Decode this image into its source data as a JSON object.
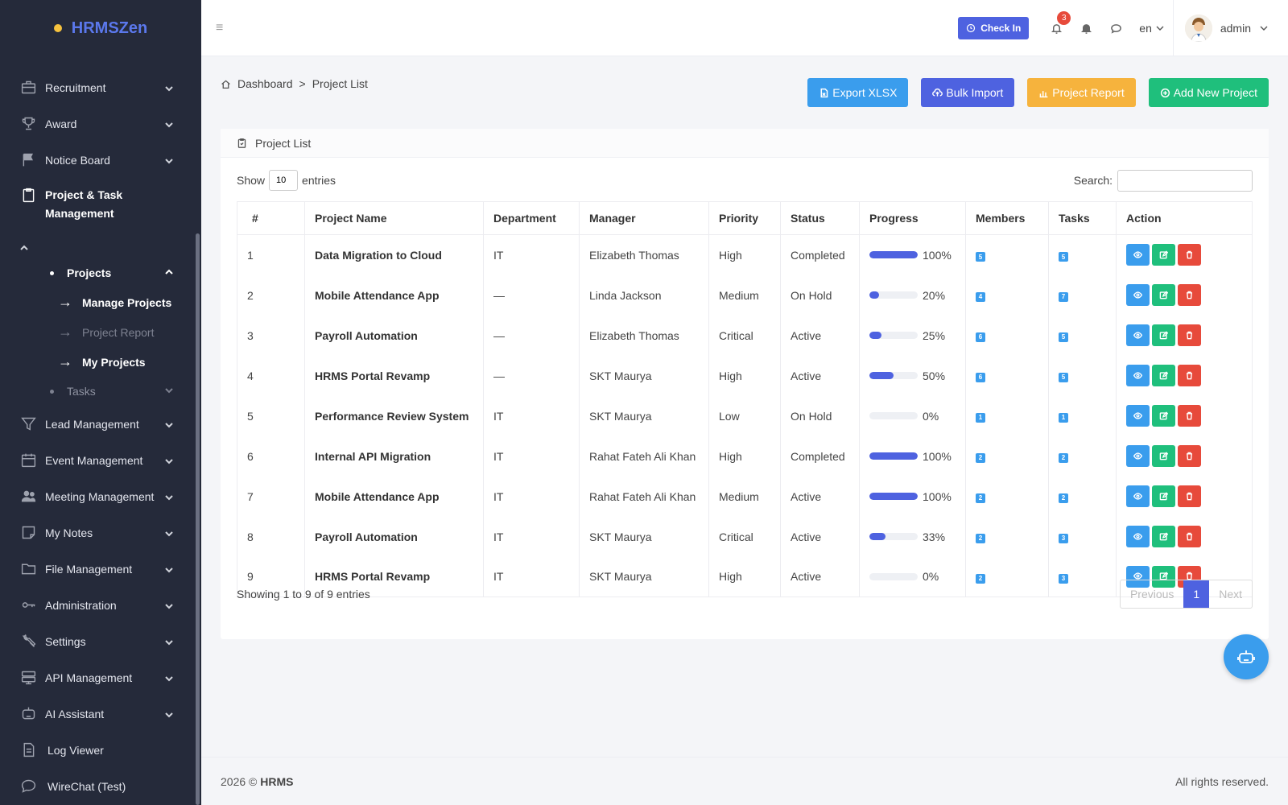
{
  "brand": {
    "name": "HRMSZen"
  },
  "sidebar": {
    "items": [
      {
        "label": "Recruitment",
        "icon": "briefcase-icon"
      },
      {
        "label": "Award",
        "icon": "trophy-icon"
      },
      {
        "label": "Notice Board",
        "icon": "flag-icon"
      },
      {
        "label": "Project & Task Management",
        "icon": "clipboard-icon"
      },
      {
        "label": "Lead Management",
        "icon": "funnel-icon"
      },
      {
        "label": "Event Management",
        "icon": "calendar-icon"
      },
      {
        "label": "Meeting Management",
        "icon": "users-icon"
      },
      {
        "label": "My Notes",
        "icon": "note-icon"
      },
      {
        "label": "File Management",
        "icon": "folder-icon"
      },
      {
        "label": "Administration",
        "icon": "key-icon"
      },
      {
        "label": "Settings",
        "icon": "wrench-icon"
      },
      {
        "label": "API Management",
        "icon": "server-icon"
      },
      {
        "label": "AI Assistant",
        "icon": "robot-icon"
      },
      {
        "label": "Log Viewer",
        "icon": "document-icon"
      },
      {
        "label": "WireChat (Test)",
        "icon": "chat-icon"
      }
    ],
    "projects_label": "Projects",
    "sub_items": [
      "Manage Projects",
      "Project Report",
      "My Projects"
    ],
    "tasks_label": "Tasks"
  },
  "header": {
    "checkin_label": "Check In",
    "notification_count": "3",
    "language": "en",
    "username": "admin"
  },
  "breadcrumb": {
    "home": "Dashboard",
    "separator": ">",
    "current": "Project List"
  },
  "actions": {
    "export": "Export XLSX",
    "bulk": "Bulk Import",
    "report": "Project Report",
    "add": "Add New Project"
  },
  "card": {
    "title": "Project List"
  },
  "datatable": {
    "show_label": "Show",
    "page_length": "10",
    "entries_label": "entries",
    "search_label": "Search:",
    "search_value": "",
    "columns": [
      "#",
      "Project Name",
      "Department",
      "Manager",
      "Priority",
      "Status",
      "Progress",
      "Members",
      "Tasks",
      "Action"
    ],
    "rows": [
      {
        "n": "1",
        "name": "Data Migration to Cloud",
        "dept": "IT",
        "manager": "Elizabeth Thomas",
        "priority": "High",
        "status": "Completed",
        "progress": 100,
        "progress_label": "100%",
        "members": "5",
        "tasks": "5"
      },
      {
        "n": "2",
        "name": "Mobile Attendance App",
        "dept": "—",
        "manager": "Linda Jackson",
        "priority": "Medium",
        "status": "On Hold",
        "progress": 20,
        "progress_label": "20%",
        "members": "4",
        "tasks": "7"
      },
      {
        "n": "3",
        "name": "Payroll Automation",
        "dept": "—",
        "manager": "Elizabeth Thomas",
        "priority": "Critical",
        "status": "Active",
        "progress": 25,
        "progress_label": "25%",
        "members": "6",
        "tasks": "5"
      },
      {
        "n": "4",
        "name": "HRMS Portal Revamp",
        "dept": "—",
        "manager": "SKT Maurya",
        "priority": "High",
        "status": "Active",
        "progress": 50,
        "progress_label": "50%",
        "members": "6",
        "tasks": "5"
      },
      {
        "n": "5",
        "name": "Performance Review System",
        "dept": "IT",
        "manager": "SKT Maurya",
        "priority": "Low",
        "status": "On Hold",
        "progress": 0,
        "progress_label": "0%",
        "members": "1",
        "tasks": "1"
      },
      {
        "n": "6",
        "name": "Internal API Migration",
        "dept": "IT",
        "manager": "Rahat Fateh Ali Khan",
        "priority": "High",
        "status": "Completed",
        "progress": 100,
        "progress_label": "100%",
        "members": "2",
        "tasks": "2"
      },
      {
        "n": "7",
        "name": "Mobile Attendance App",
        "dept": "IT",
        "manager": "Rahat Fateh Ali Khan",
        "priority": "Medium",
        "status": "Active",
        "progress": 100,
        "progress_label": "100%",
        "members": "2",
        "tasks": "2"
      },
      {
        "n": "8",
        "name": "Payroll Automation",
        "dept": "IT",
        "manager": "SKT Maurya",
        "priority": "Critical",
        "status": "Active",
        "progress": 33,
        "progress_label": "33%",
        "members": "2",
        "tasks": "3"
      },
      {
        "n": "9",
        "name": "HRMS Portal Revamp",
        "dept": "IT",
        "manager": "SKT Maurya",
        "priority": "High",
        "status": "Active",
        "progress": 0,
        "progress_label": "0%",
        "members": "2",
        "tasks": "3"
      }
    ],
    "info": "Showing 1 to 9 of 9 entries",
    "prev": "Previous",
    "page": "1",
    "next": "Next"
  },
  "footer": {
    "year": "2026 ©",
    "brand": "HRMS",
    "rights": "All rights reserved."
  },
  "colors": {
    "primary": "#4e62e0",
    "info": "#3a9ded",
    "success": "#1fbf7c",
    "warning": "#f6b33d",
    "danger": "#e74a3b",
    "sidebar": "#252a3a"
  }
}
